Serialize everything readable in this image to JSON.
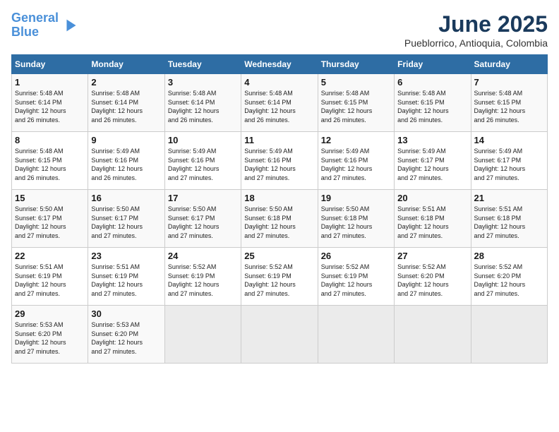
{
  "logo": {
    "line1": "General",
    "line2": "Blue"
  },
  "title": "June 2025",
  "subtitle": "Pueblorrico, Antioquia, Colombia",
  "days_of_week": [
    "Sunday",
    "Monday",
    "Tuesday",
    "Wednesday",
    "Thursday",
    "Friday",
    "Saturday"
  ],
  "weeks": [
    [
      {
        "day": "1",
        "info": "Sunrise: 5:48 AM\nSunset: 6:14 PM\nDaylight: 12 hours\nand 26 minutes."
      },
      {
        "day": "2",
        "info": "Sunrise: 5:48 AM\nSunset: 6:14 PM\nDaylight: 12 hours\nand 26 minutes."
      },
      {
        "day": "3",
        "info": "Sunrise: 5:48 AM\nSunset: 6:14 PM\nDaylight: 12 hours\nand 26 minutes."
      },
      {
        "day": "4",
        "info": "Sunrise: 5:48 AM\nSunset: 6:14 PM\nDaylight: 12 hours\nand 26 minutes."
      },
      {
        "day": "5",
        "info": "Sunrise: 5:48 AM\nSunset: 6:15 PM\nDaylight: 12 hours\nand 26 minutes."
      },
      {
        "day": "6",
        "info": "Sunrise: 5:48 AM\nSunset: 6:15 PM\nDaylight: 12 hours\nand 26 minutes."
      },
      {
        "day": "7",
        "info": "Sunrise: 5:48 AM\nSunset: 6:15 PM\nDaylight: 12 hours\nand 26 minutes."
      }
    ],
    [
      {
        "day": "8",
        "info": "Sunrise: 5:48 AM\nSunset: 6:15 PM\nDaylight: 12 hours\nand 26 minutes."
      },
      {
        "day": "9",
        "info": "Sunrise: 5:49 AM\nSunset: 6:16 PM\nDaylight: 12 hours\nand 26 minutes."
      },
      {
        "day": "10",
        "info": "Sunrise: 5:49 AM\nSunset: 6:16 PM\nDaylight: 12 hours\nand 27 minutes."
      },
      {
        "day": "11",
        "info": "Sunrise: 5:49 AM\nSunset: 6:16 PM\nDaylight: 12 hours\nand 27 minutes."
      },
      {
        "day": "12",
        "info": "Sunrise: 5:49 AM\nSunset: 6:16 PM\nDaylight: 12 hours\nand 27 minutes."
      },
      {
        "day": "13",
        "info": "Sunrise: 5:49 AM\nSunset: 6:17 PM\nDaylight: 12 hours\nand 27 minutes."
      },
      {
        "day": "14",
        "info": "Sunrise: 5:49 AM\nSunset: 6:17 PM\nDaylight: 12 hours\nand 27 minutes."
      }
    ],
    [
      {
        "day": "15",
        "info": "Sunrise: 5:50 AM\nSunset: 6:17 PM\nDaylight: 12 hours\nand 27 minutes."
      },
      {
        "day": "16",
        "info": "Sunrise: 5:50 AM\nSunset: 6:17 PM\nDaylight: 12 hours\nand 27 minutes."
      },
      {
        "day": "17",
        "info": "Sunrise: 5:50 AM\nSunset: 6:17 PM\nDaylight: 12 hours\nand 27 minutes."
      },
      {
        "day": "18",
        "info": "Sunrise: 5:50 AM\nSunset: 6:18 PM\nDaylight: 12 hours\nand 27 minutes."
      },
      {
        "day": "19",
        "info": "Sunrise: 5:50 AM\nSunset: 6:18 PM\nDaylight: 12 hours\nand 27 minutes."
      },
      {
        "day": "20",
        "info": "Sunrise: 5:51 AM\nSunset: 6:18 PM\nDaylight: 12 hours\nand 27 minutes."
      },
      {
        "day": "21",
        "info": "Sunrise: 5:51 AM\nSunset: 6:18 PM\nDaylight: 12 hours\nand 27 minutes."
      }
    ],
    [
      {
        "day": "22",
        "info": "Sunrise: 5:51 AM\nSunset: 6:19 PM\nDaylight: 12 hours\nand 27 minutes."
      },
      {
        "day": "23",
        "info": "Sunrise: 5:51 AM\nSunset: 6:19 PM\nDaylight: 12 hours\nand 27 minutes."
      },
      {
        "day": "24",
        "info": "Sunrise: 5:52 AM\nSunset: 6:19 PM\nDaylight: 12 hours\nand 27 minutes."
      },
      {
        "day": "25",
        "info": "Sunrise: 5:52 AM\nSunset: 6:19 PM\nDaylight: 12 hours\nand 27 minutes."
      },
      {
        "day": "26",
        "info": "Sunrise: 5:52 AM\nSunset: 6:19 PM\nDaylight: 12 hours\nand 27 minutes."
      },
      {
        "day": "27",
        "info": "Sunrise: 5:52 AM\nSunset: 6:20 PM\nDaylight: 12 hours\nand 27 minutes."
      },
      {
        "day": "28",
        "info": "Sunrise: 5:52 AM\nSunset: 6:20 PM\nDaylight: 12 hours\nand 27 minutes."
      }
    ],
    [
      {
        "day": "29",
        "info": "Sunrise: 5:53 AM\nSunset: 6:20 PM\nDaylight: 12 hours\nand 27 minutes."
      },
      {
        "day": "30",
        "info": "Sunrise: 5:53 AM\nSunset: 6:20 PM\nDaylight: 12 hours\nand 27 minutes."
      },
      {
        "day": "",
        "info": ""
      },
      {
        "day": "",
        "info": ""
      },
      {
        "day": "",
        "info": ""
      },
      {
        "day": "",
        "info": ""
      },
      {
        "day": "",
        "info": ""
      }
    ]
  ]
}
